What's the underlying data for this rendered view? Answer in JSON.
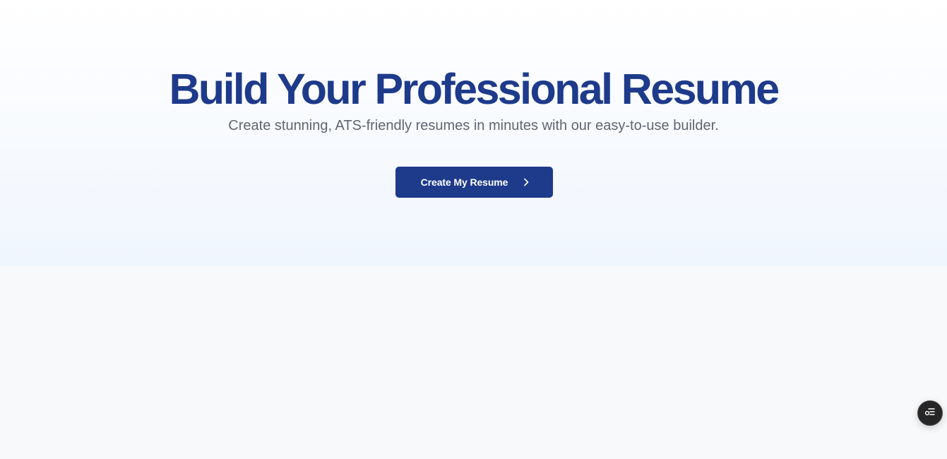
{
  "hero": {
    "title": "Build Your Professional Resume",
    "subtitle": "Create stunning, ATS-friendly resumes in minutes with our easy-to-use builder.",
    "cta_label": "Create My Resume",
    "cta_icon": "chevron-right-icon"
  },
  "floating_button": {
    "icon": "toggle-list-icon"
  },
  "colors": {
    "brand": "#1e3a8a",
    "subtitle_text": "#5f6670",
    "page_background": "#f8f9fb",
    "hero_gradient_end": "#f0f6fe",
    "fab_background": "#262626"
  }
}
